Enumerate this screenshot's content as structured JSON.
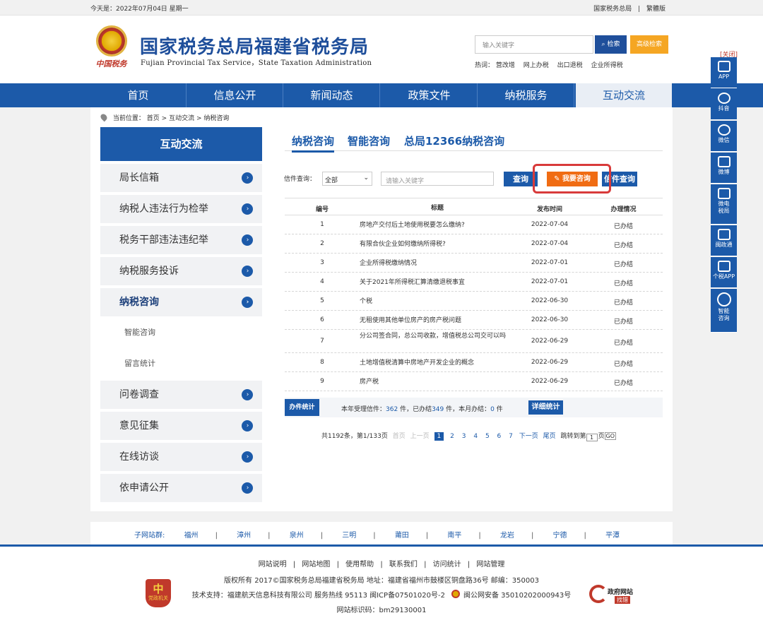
{
  "topbar": {
    "date": "今天是：2022年07月04日 星期一",
    "links": [
      "国家税务总局",
      "|",
      "繁體版"
    ]
  },
  "header": {
    "emblem_caption": "中国税务",
    "title": "国家税务总局福建省税务局",
    "subtitle": "Fujian Provincial Tax Service，State Taxation Administration",
    "search_placeholder": "输入关键字",
    "search_button": "检索",
    "advanced_button": "高级检索",
    "hot_label": "热词：",
    "hot_words": [
      "营改增",
      "网上办税",
      "出口退税",
      "企业所得税"
    ]
  },
  "nav": {
    "items": [
      "首页",
      "信息公开",
      "新闻动态",
      "政策文件",
      "纳税服务",
      "互动交流"
    ],
    "active": "互动交流"
  },
  "breadcrumb": {
    "label": "当前位置：",
    "items": [
      "首页",
      ">",
      "互动交流",
      ">",
      "纳税咨询"
    ]
  },
  "sidebar": {
    "title": "互动交流",
    "items": [
      "局长信箱",
      "纳税人违法行为检举",
      "税务干部违法违纪举",
      "纳税服务投诉",
      "纳税咨询",
      "问卷调查",
      "意见征集",
      "在线访谈",
      "依申请公开"
    ],
    "active": "纳税咨询",
    "subitems": [
      "智能咨询",
      "留言统计"
    ]
  },
  "tabs": [
    "纳税咨询",
    "智能咨询",
    "总局12366纳税咨询"
  ],
  "query": {
    "label": "信件查询：",
    "select_value": "全部",
    "input_placeholder": "请输入关键字",
    "query_button": "查询",
    "consult_button": "我要咨询",
    "letter_button": "信件查询",
    "highlight_color": "#d83a3a"
  },
  "table": {
    "headers": [
      "编号",
      "标题",
      "发布时间",
      "办理情况"
    ],
    "rows": [
      {
        "no": "1",
        "title": "房地产交付后土地使用税要怎么缴纳?",
        "date": "2022-07-04",
        "status": "已办结"
      },
      {
        "no": "2",
        "title": "有限合伙企业如何缴纳所得税?",
        "date": "2022-07-04",
        "status": "已办结"
      },
      {
        "no": "3",
        "title": "企业所得税缴纳情况",
        "date": "2022-07-01",
        "status": "已办结"
      },
      {
        "no": "4",
        "title": "关于2021年所得税汇算清缴退税事宜",
        "date": "2022-07-01",
        "status": "已办结"
      },
      {
        "no": "5",
        "title": "个税",
        "date": "2022-06-30",
        "status": "已办结"
      },
      {
        "no": "6",
        "title": "无租使用其他单位房产的房产税问题",
        "date": "2022-06-30",
        "status": "已办结"
      },
      {
        "no": "7",
        "title": "分公司签合同，总公司收款，增值税总公司交可以吗",
        "date": "2022-06-29",
        "status": "已办结"
      },
      {
        "no": "8",
        "title": "土地增值税清算中房地产开发企业的概念",
        "date": "2022-06-29",
        "status": "已办结"
      },
      {
        "no": "9",
        "title": "房产税",
        "date": "2022-06-29",
        "status": "已办结"
      }
    ]
  },
  "stats": {
    "tag": "办件统计",
    "p1": "本年受理信件：",
    "year_received": "362",
    "p2": " 件，已办结",
    "year_done": "349",
    "p3": " 件，本月办结：",
    "month_done": "0",
    "p4": " 件",
    "detail_button": "详细统计"
  },
  "pager": {
    "summary": "共1192条，第1/133页",
    "first": "首页",
    "prev": "上一页",
    "pages": [
      "1",
      "2",
      "3",
      "4",
      "5",
      "6",
      "7"
    ],
    "current": "1",
    "next": "下一页",
    "last": "尾页",
    "jump_label": "跳转到第",
    "jump_value": "1",
    "page_suffix": "页",
    "go": "GO"
  },
  "sub_sites": {
    "label": "子网站群:",
    "sites": [
      "福州",
      "漳州",
      "泉州",
      "三明",
      "莆田",
      "南平",
      "龙岩",
      "宁德",
      "平潭"
    ]
  },
  "footer": {
    "links": [
      "网站说明",
      "|",
      "网站地图",
      "|",
      "使用帮助",
      "|",
      "联系我们",
      "|",
      "访问统计",
      "|",
      "网站管理"
    ],
    "copyright": "版权所有 2017©国家税务总局福建省税务局 地址：福建省福州市鼓楼区铜盘路36号 邮编：350003",
    "support": "技术支持：福建航天信息科技有限公司 服务热线 95113 闽ICP备07501020号-2",
    "police": "闽公网安备 35010202000943号",
    "site_id": "网站标识码：bm29130001",
    "badge_big": "中",
    "badge_small": "党政机关",
    "gov_err_1": "政府网站",
    "gov_err_2": "找错"
  },
  "float_bar": {
    "close": "[关闭]",
    "items": [
      "APP",
      "抖音",
      "微信",
      "微博",
      "微电税局",
      "闽政通",
      "个税APP",
      "智能咨询"
    ]
  }
}
